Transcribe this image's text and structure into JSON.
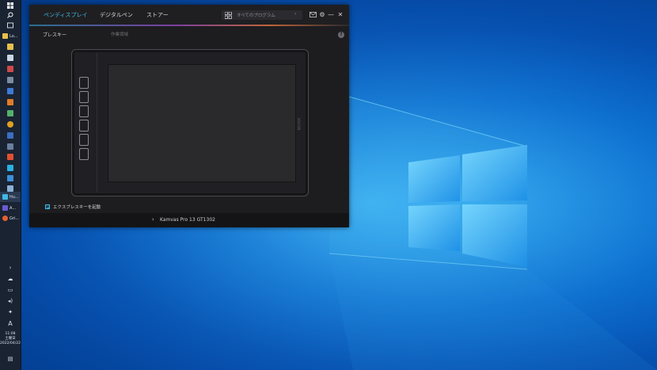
{
  "taskbar": {
    "apps": [
      {
        "label": "Lo..."
      },
      {
        "label": "Hu..."
      },
      {
        "label": "A..."
      },
      {
        "label": "Gri..."
      }
    ],
    "clock": {
      "time": "11:08",
      "day": "土曜日",
      "date": "2022/04/22"
    },
    "ime_indicator": "A"
  },
  "window": {
    "nav": {
      "tabs": [
        {
          "label": "ペンディスプレイ",
          "active": true
        },
        {
          "label": "デジタルペン",
          "active": false
        },
        {
          "label": "ストアー",
          "active": false
        }
      ]
    },
    "search": {
      "placeholder": "すべてのプログラム"
    },
    "section": {
      "label": "プレスキー",
      "sub": "作業領域",
      "help": "?"
    },
    "tablet": {
      "brand": "HUION",
      "press_keys": 6
    },
    "options": {
      "express_keys_label": "エクスプレスキーを起動",
      "express_keys_checked": true
    },
    "footer": {
      "device_name": "Kamvas Pro 13 GT1302"
    }
  },
  "colors": {
    "accent": "#3fb8e4",
    "window_bg": "#1d1d20",
    "wallpaper": "#0b6fd0"
  }
}
